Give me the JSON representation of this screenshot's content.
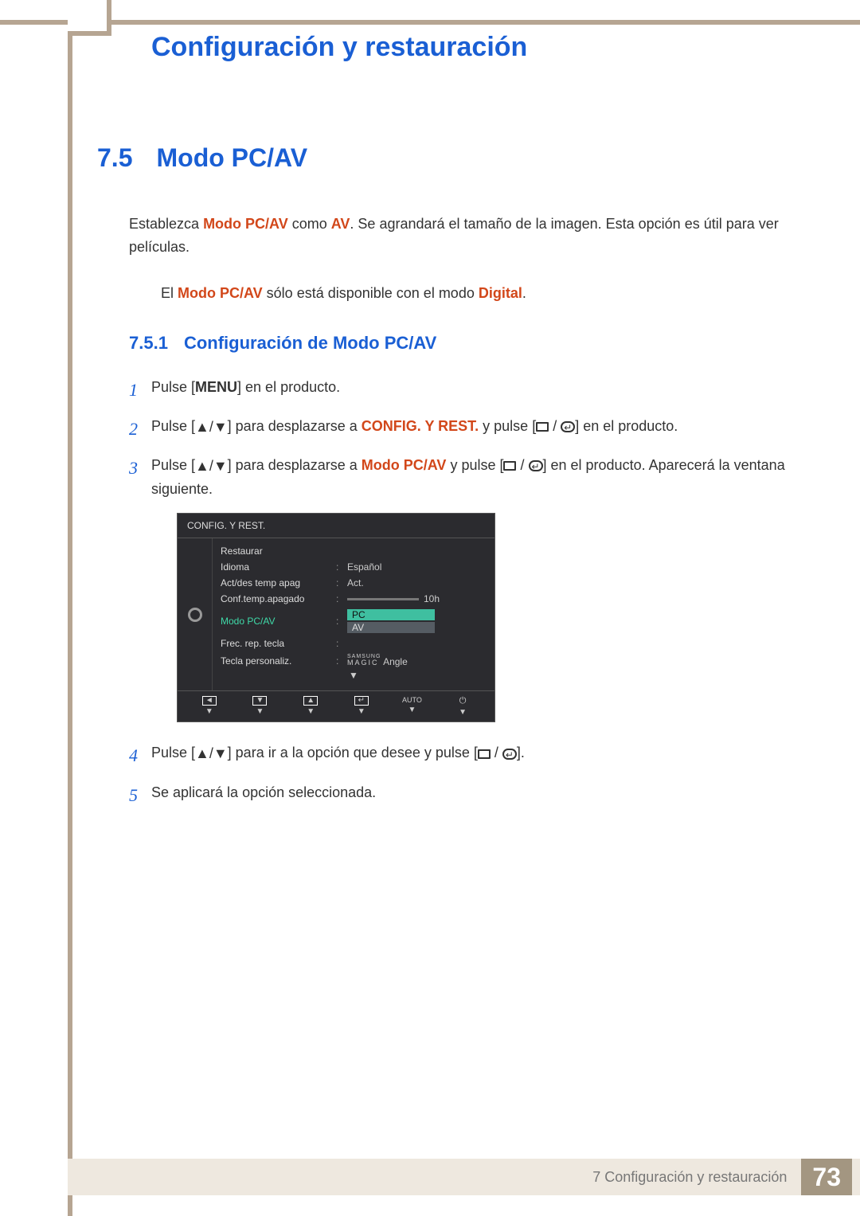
{
  "header": {
    "title": "Configuración y restauración"
  },
  "section": {
    "number": "7.5",
    "title": "Modo PC/AV"
  },
  "intro": {
    "pre": "Establezca ",
    "hl1": "Modo PC/AV",
    "mid": " como ",
    "hl2": "AV",
    "post": ". Se agrandará el tamaño de la imagen. Esta opción es útil para ver películas."
  },
  "note": {
    "pre": "El ",
    "hl1": "Modo PC/AV",
    "mid": " sólo está disponible con el modo ",
    "hl2": "Digital",
    "post": "."
  },
  "subsection": {
    "number": "7.5.1",
    "title": "Configuración de Modo PC/AV"
  },
  "steps": {
    "s1": {
      "num": "1",
      "t1": "Pulse [",
      "menu": "MENU",
      "t2": "] en el producto."
    },
    "s2": {
      "num": "2",
      "t1": "Pulse [",
      "arrows": "▲/▼",
      "t2": "] para desplazarse a ",
      "hl": "CONFIG. Y REST.",
      "t3": " y pulse [",
      "t4": "] en el producto."
    },
    "s3": {
      "num": "3",
      "t1": "Pulse [",
      "arrows": "▲/▼",
      "t2": "] para desplazarse a ",
      "hl": "Modo PC/AV",
      "t3": " y pulse [",
      "t4": "] en el producto. Aparecerá la ventana siguiente."
    },
    "s4": {
      "num": "4",
      "t1": "Pulse [",
      "arrows": "▲/▼",
      "t2": "] para ir a la opción que desee y pulse [",
      "t3": "]."
    },
    "s5": {
      "num": "5",
      "text": "Se aplicará la opción seleccionada."
    }
  },
  "osd": {
    "title": "CONFIG. Y REST.",
    "rows": {
      "restaurar": {
        "label": "Restaurar"
      },
      "idioma": {
        "label": "Idioma",
        "value": "Español"
      },
      "actdes": {
        "label": "Act/des temp apag",
        "value": "Act."
      },
      "conftemp": {
        "label": "Conf.temp.apagado",
        "value": "10h"
      },
      "modo": {
        "label": "Modo PC/AV",
        "pc": "PC",
        "av": "AV"
      },
      "frec": {
        "label": "Frec. rep. tecla"
      },
      "tecla": {
        "label": "Tecla personaliz.",
        "brand_top": "SAMSUNG",
        "brand": "MAGIC",
        "value_suffix": " Angle"
      }
    },
    "footer": {
      "auto": "AUTO"
    }
  },
  "footer": {
    "text": "7 Configuración y restauración",
    "page": "73"
  }
}
